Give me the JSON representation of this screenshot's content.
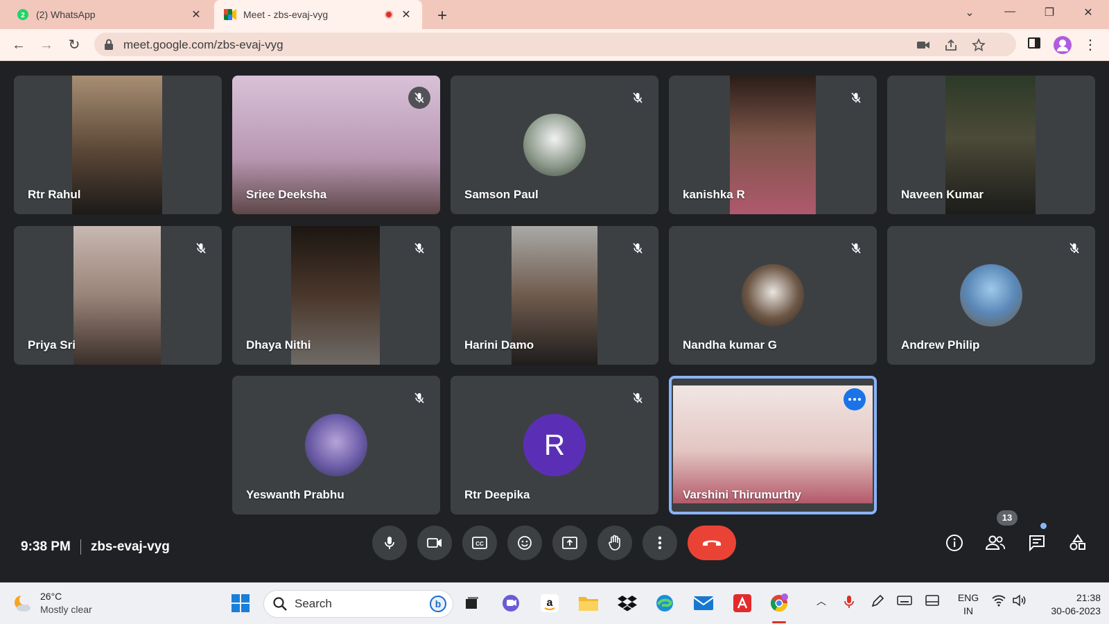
{
  "browser": {
    "tabs": [
      {
        "title": "(2) WhatsApp",
        "badge": "2"
      },
      {
        "title": "Meet - zbs-evaj-vyg"
      }
    ],
    "url": "meet.google.com/zbs-evaj-vyg"
  },
  "participants": [
    {
      "name": "Rtr Rahul",
      "muted": false,
      "video": "#6b5a4a"
    },
    {
      "name": "Sriee Deeksha",
      "muted": true,
      "video": "#c9a9c6"
    },
    {
      "name": "Samson Paul",
      "muted": true,
      "avatar": "photo"
    },
    {
      "name": "kanishka R",
      "muted": true,
      "video": "#3b2a25"
    },
    {
      "name": "Naveen Kumar",
      "muted": false,
      "video": "#2f3326"
    },
    {
      "name": "Priya Sri",
      "muted": true,
      "video": "#8d7a70"
    },
    {
      "name": "Dhaya Nithi",
      "muted": true,
      "video": "#2a221c"
    },
    {
      "name": "Harini Damo",
      "muted": true,
      "video": "#7a7a78"
    },
    {
      "name": "Nandha kumar G",
      "muted": true,
      "avatar": "photo"
    },
    {
      "name": "Andrew Philip",
      "muted": true,
      "avatar": "photo"
    },
    {
      "name": "Yeswanth Prabhu",
      "muted": true,
      "avatar": "photo"
    },
    {
      "name": "Rtr Deepika",
      "muted": true,
      "avatar_letter": "R",
      "avatar_color": "#5b2fb5"
    },
    {
      "name": "Varshini Thirumurthy",
      "muted": false,
      "video": "#e8c9c6",
      "active": true
    }
  ],
  "meeting": {
    "time": "9:38 PM",
    "code": "zbs-evaj-vyg",
    "participant_count": "13"
  },
  "taskbar": {
    "temperature": "26°C",
    "condition": "Mostly clear",
    "search_label": "Search",
    "lang_top": "ENG",
    "lang_bottom": "IN",
    "time": "21:38",
    "date": "30-06-2023"
  },
  "colors": {
    "accent": "#1a73e8",
    "end_call": "#ea4335",
    "tile_bg": "#3c4043",
    "stage_bg": "#202124"
  }
}
